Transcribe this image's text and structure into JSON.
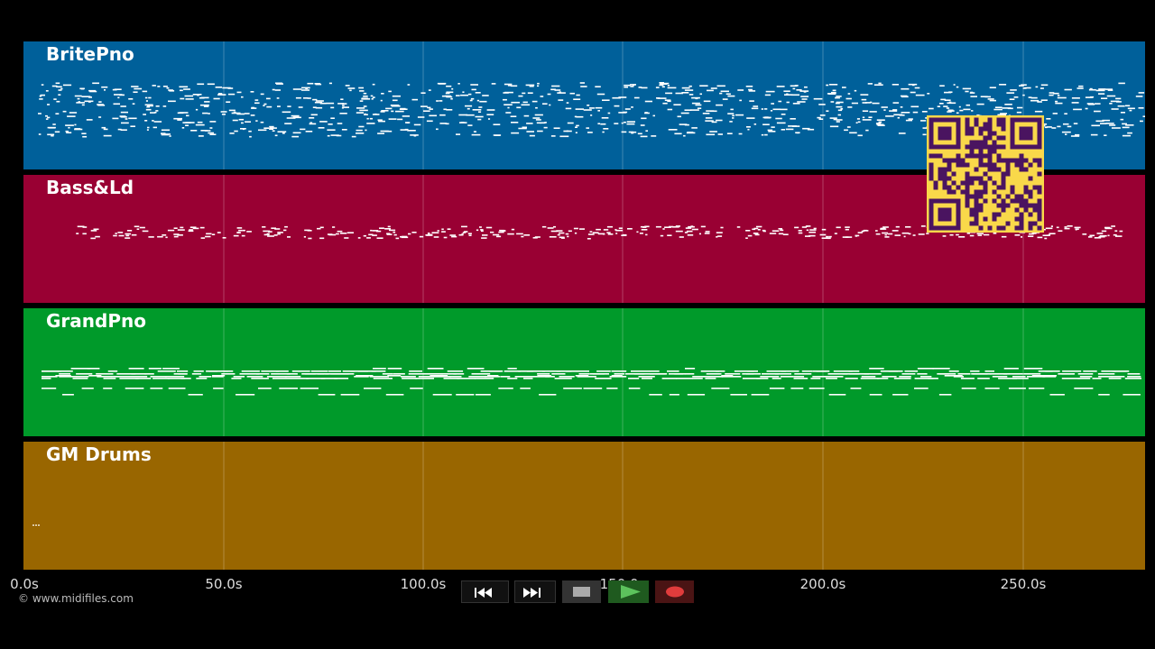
{
  "tracks": [
    {
      "name": "BritePno",
      "color": "#00609a"
    },
    {
      "name": "Bass&Ld",
      "color": "#990033"
    },
    {
      "name": "GrandPno",
      "color": "#009a2a"
    },
    {
      "name": "GM Drums",
      "color": "#996600"
    }
  ],
  "timeline": {
    "ticks": [
      "0.0s",
      "50.0s",
      "100.0s",
      "150.0s",
      "200.0s",
      "250.0s"
    ],
    "max_seconds": 281
  },
  "copyright": "© www.midifiles.com",
  "transport": {
    "rewind_icon": "rewind-icon",
    "forward_icon": "fast-forward-icon",
    "stop_icon": "stop-icon",
    "play_icon": "play-icon",
    "record_icon": "record-icon"
  },
  "qr": {
    "icon": "qr-code-icon",
    "color": "#4a1460"
  }
}
